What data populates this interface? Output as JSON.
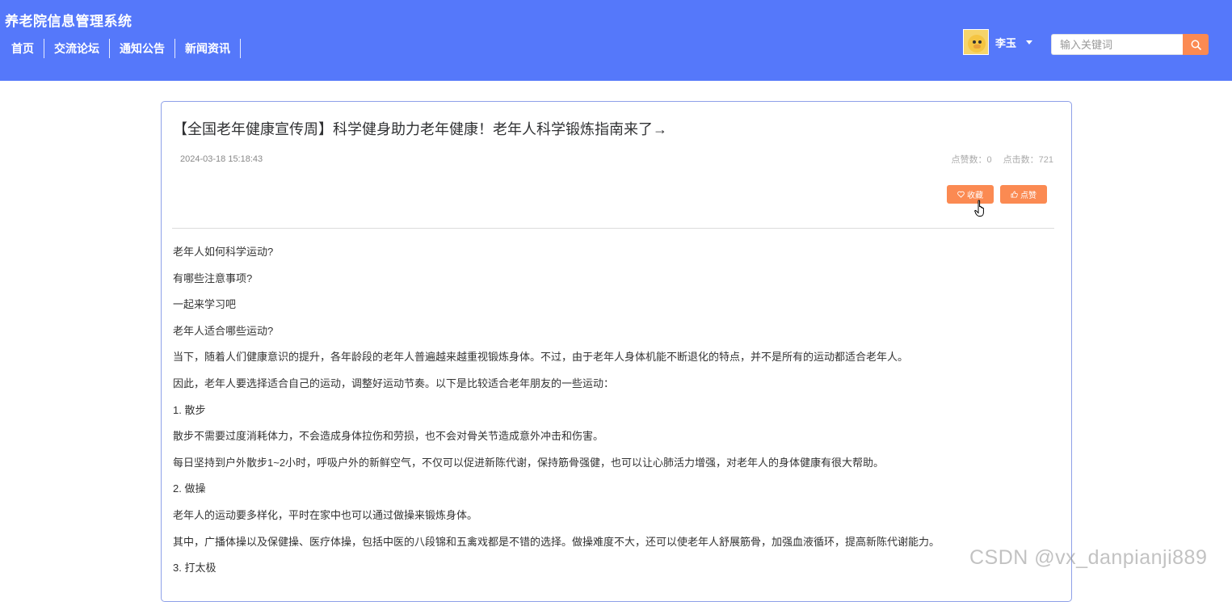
{
  "header": {
    "app_title": "养老院信息管理系统",
    "nav": [
      {
        "label": "首页"
      },
      {
        "label": "交流论坛"
      },
      {
        "label": "通知公告"
      },
      {
        "label": "新闻资讯"
      }
    ],
    "user": {
      "name": "李玉"
    },
    "search": {
      "placeholder": "输入关键词"
    },
    "bg_color": "#5578fa",
    "accent_color": "#fb8a52"
  },
  "article": {
    "title": "【全国老年健康宣传周】科学健身助力老年健康！老年人科学锻炼指南来了→",
    "date": "2024-03-18 15:18:43",
    "likes_label": "点赞数：0",
    "clicks_label": "点击数：721",
    "favorite_label": "收藏",
    "like_label": "点赞",
    "paragraphs": [
      "老年人如何科学运动?",
      "有哪些注意事项?",
      "一起来学习吧",
      "老年人适合哪些运动?",
      "当下，随着人们健康意识的提升，各年龄段的老年人普遍越来越重视锻炼身体。不过，由于老年人身体机能不断退化的特点，并不是所有的运动都适合老年人。",
      "因此，老年人要选择适合自己的运动，调整好运动节奏。以下是比较适合老年朋友的一些运动：",
      "1. 散步",
      "散步不需要过度消耗体力，不会造成身体拉伤和劳损，也不会对骨关节造成意外冲击和伤害。",
      "每日坚持到户外散步1~2小时，呼吸户外的新鲜空气，不仅可以促进新陈代谢，保持筋骨强健，也可以让心肺活力增强，对老年人的身体健康有很大帮助。",
      "2. 做操",
      "老年人的运动要多样化，平时在家中也可以通过做操来锻炼身体。",
      "其中，广播体操以及保健操、医疗体操，包括中医的八段锦和五禽戏都是不错的选择。做操难度不大，还可以使老年人舒展筋骨，加强血液循环，提高新陈代谢能力。",
      "3. 打太极"
    ]
  },
  "watermark": "CSDN @vx_danpianji889"
}
